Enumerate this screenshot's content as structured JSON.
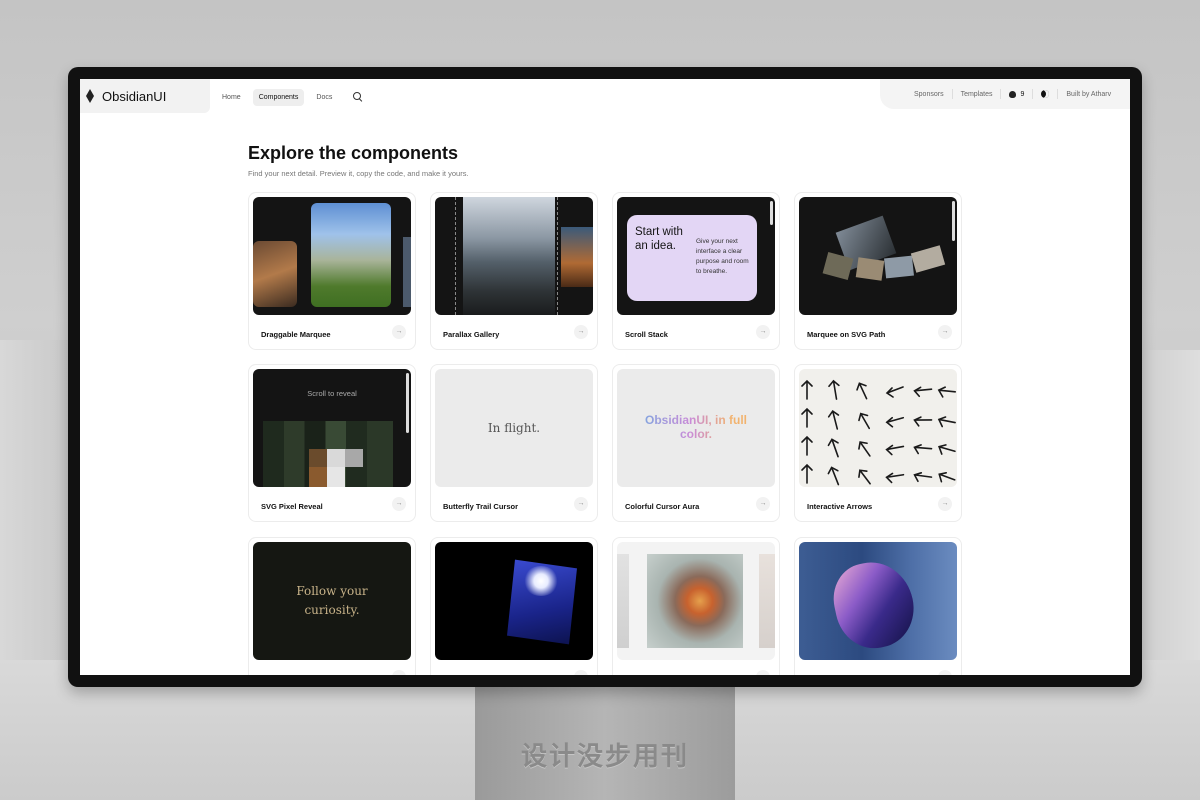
{
  "app": {
    "name": "ObsidianUI"
  },
  "nav": {
    "items": [
      {
        "label": "Home",
        "active": false
      },
      {
        "label": "Components",
        "active": true
      },
      {
        "label": "Docs",
        "active": false
      }
    ]
  },
  "header_right": {
    "sponsors": "Sponsors",
    "templates": "Templates",
    "stars": "9",
    "built_by": "Built by Atharv"
  },
  "page": {
    "title": "Explore the components",
    "subtitle": "Find your next detail. Preview it, copy the code, and make it yours."
  },
  "cards": [
    {
      "label": "Draggable Marquee"
    },
    {
      "label": "Parallax Gallery"
    },
    {
      "label": "Scroll Stack"
    },
    {
      "label": "Marquee on SVG Path"
    },
    {
      "label": "SVG Pixel Reveal"
    },
    {
      "label": "Butterfly Trail Cursor"
    },
    {
      "label": "Colorful Cursor Aura"
    },
    {
      "label": "Interactive Arrows"
    },
    {
      "label": ""
    },
    {
      "label": ""
    },
    {
      "label": ""
    },
    {
      "label": ""
    }
  ],
  "previews": {
    "scroll_stack_heading": "Start with an idea.",
    "scroll_stack_body": "Give your next interface a clear purpose and room to breathe.",
    "pixel_reveal_text": "Scroll to reveal",
    "butterfly_text": "In flight.",
    "aura_text": "ObsidianUI, in full color.",
    "follow_text": "Follow your curiosity."
  },
  "stand_text": "设计没步用刊",
  "colors": {
    "accent_purple": "#e3d6f5",
    "dark_card": "#141414"
  }
}
